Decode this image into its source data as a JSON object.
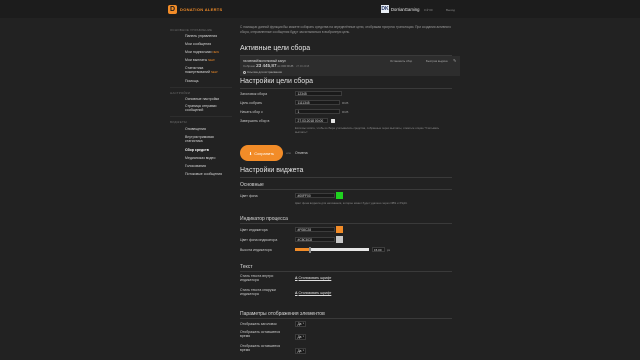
{
  "topbar": {
    "logo_letter": "D",
    "brand": "DONATION ALERTS",
    "avatar_letters": "DK",
    "username": "DorrianGaming",
    "balance": "0 ₽ 00",
    "logout": "Выход"
  },
  "sidebar": {
    "sections": [
      {
        "title": "Основное управление",
        "items": [
          {
            "label": "Панель управления",
            "badge": ""
          },
          {
            "label": "Мои сообщения",
            "badge": ""
          },
          {
            "label": "Мои подписчики",
            "badge": "NEW"
          },
          {
            "label": "Мои выплаты",
            "badge": "NEW"
          },
          {
            "label": "Статистика пожертвований",
            "badge": "NEW"
          },
          {
            "label": "Помощь",
            "badge": ""
          }
        ]
      },
      {
        "title": "Настройки",
        "items": [
          {
            "label": "Основные настройки",
            "badge": ""
          },
          {
            "label": "Страница отправки сообщений",
            "badge": ""
          }
        ]
      },
      {
        "title": "Виджеты",
        "items": [
          {
            "label": "Оповещения",
            "badge": ""
          },
          {
            "label": "Внутристримовая статистика",
            "badge": ""
          },
          {
            "label": "Сбор средств",
            "badge": ""
          },
          {
            "label": "Медиапоказ видео",
            "badge": ""
          },
          {
            "label": "Голосования",
            "badge": ""
          },
          {
            "label": "Потоковые сообщения",
            "badge": ""
          }
        ]
      }
    ]
  },
  "main": {
    "intro": "С помощью данной функции Вы можете собирать средства на определённые цели, отображая прогресс трансляции. При создании активного сбора, отправленные сообщения будут засчитываться в выбранную цель.",
    "active_title": "Активные цели сбора",
    "goal": {
      "name": "на мелкий/молотковый закуп",
      "collected_prefix": "Собрано",
      "collected_amount": "23 445,87",
      "total": "из 000 RUB",
      "date": "27.03.2018",
      "copy_label": "Ссылка для встраивания",
      "action_stop": "Остановить сбор",
      "action_fb": "Быстрая выдача"
    },
    "settings_title": "Настройки цели сбора",
    "fields": {
      "title_label": "Заголовок сбора",
      "title_value": "12345",
      "goal_label": "Цель собрать",
      "goal_value": "1111345",
      "goal_unit": "RUB",
      "start_label": "Начать сбор с",
      "start_value": "1",
      "start_unit": "RUB",
      "end_label": "Завершить сбор в",
      "end_value": "27.03.2018 00:00",
      "hint": "Если вы хотите, чтобы в сборе учитывались средства, собранные через выплаты, отметьте опцию \"Учитывать выплаты\"."
    },
    "save_label": "Сохранить",
    "or_label": "или",
    "cancel_label": "Отмена",
    "widget_title": "Настройки виджета",
    "basic": {
      "title": "Основные",
      "bg_label": "Цвет фона",
      "bg_value": "#00FF00",
      "bg_color": "#1fd21f",
      "bg_hint": "Цвет фона виджета для наложения, которое может будет удалено через OBS и XSplit."
    },
    "indicator": {
      "title": "Индикатор процесса",
      "color_label": "Цвет индикатора",
      "color_value": "#F08C28",
      "color_hex": "#f28c28",
      "bg_label": "Цвет фона индикатора",
      "bg_value": "#C8C8C8",
      "bg_hex": "#c8c8c8",
      "height_label": "Высота индикатора",
      "height_value": "15.00",
      "height_unit": "px",
      "height_fraction": 0.2
    },
    "text": {
      "title": "Текст",
      "inside_label": "Стиль текста внутри индикатора",
      "inside_link": "Стилизовать шрифт",
      "outside_label": "Стиль текста снаружи индикатора",
      "outside_link": "Стилизовать шрифт"
    },
    "display": {
      "title": "Параметры отображения элементов",
      "show_title_label": "Отображать заголовок",
      "show_title_value": "Да",
      "show_time_label": "Отображать оставшееся время",
      "show_time_value": "Да",
      "show_remaining_label": "Отображать оставшееся время",
      "show_remaining_value": "Да"
    }
  }
}
